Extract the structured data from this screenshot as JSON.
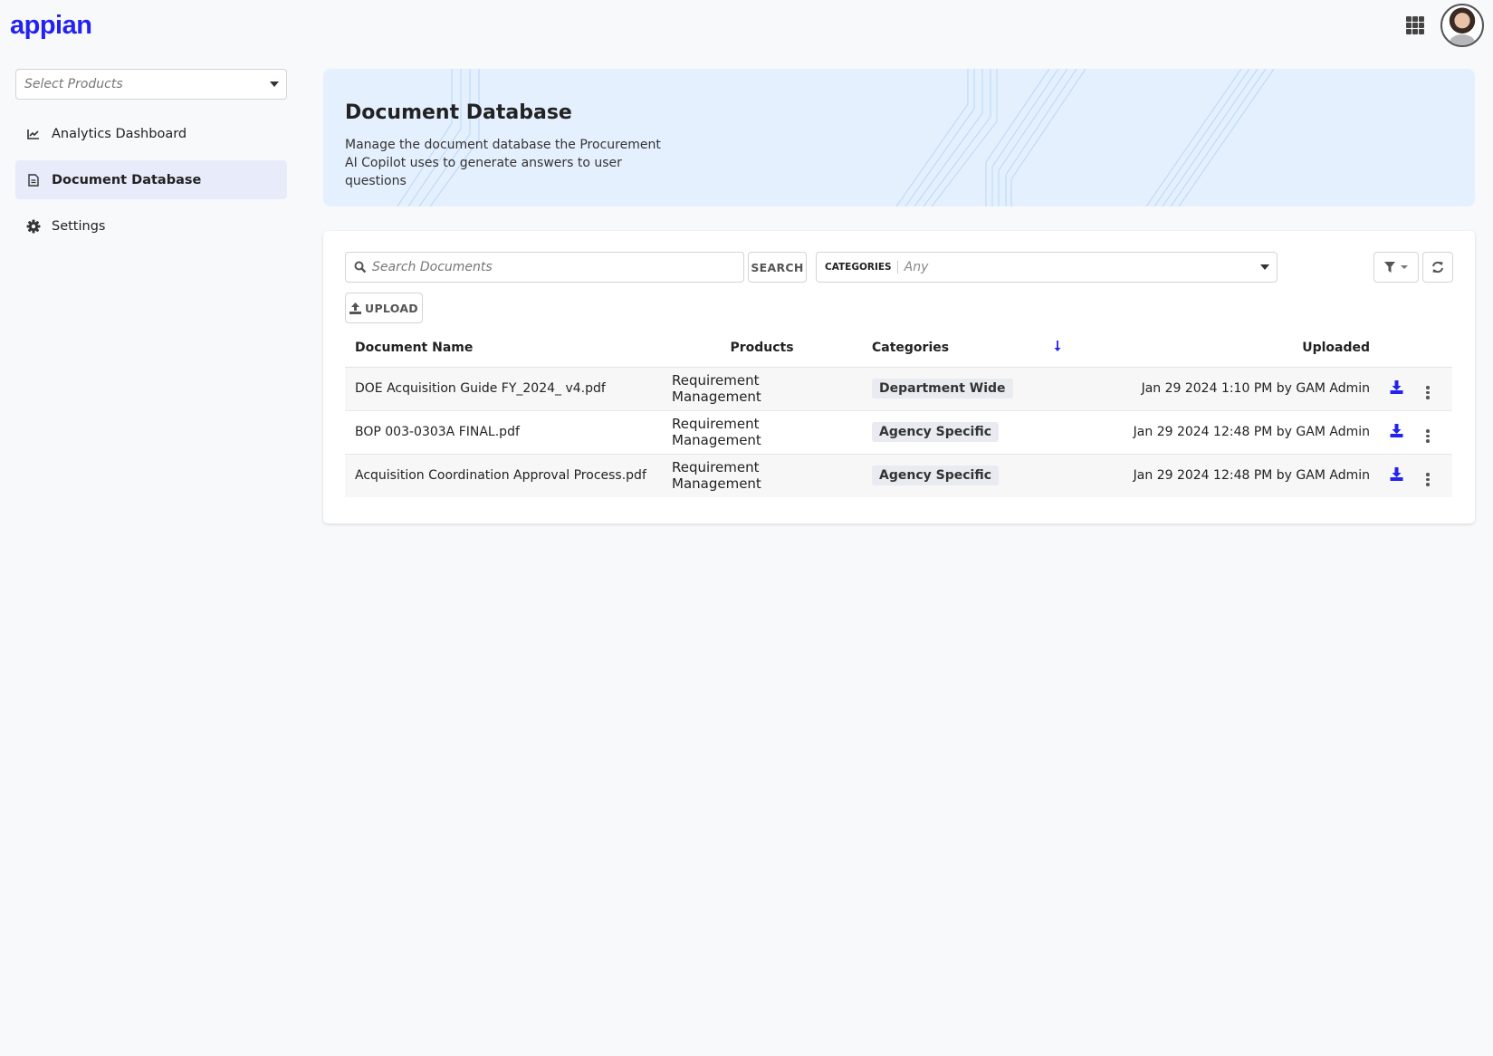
{
  "app": {
    "logo": "appian"
  },
  "topbar": {
    "apps_icon": "grid-icon",
    "avatar_alt": "user-avatar"
  },
  "sidebar": {
    "product_select": {
      "placeholder": "Select Products"
    },
    "items": [
      {
        "label": "Analytics Dashboard",
        "icon": "chart-line-icon",
        "active": false
      },
      {
        "label": "Document Database",
        "icon": "document-icon",
        "active": true
      },
      {
        "label": "Settings",
        "icon": "gear-icon",
        "active": false
      }
    ]
  },
  "header": {
    "title": "Document Database",
    "description": "Manage the document database the Procurement AI Copilot uses to generate answers to user questions"
  },
  "toolbar": {
    "search_placeholder": "Search Documents",
    "search_button": "SEARCH",
    "categories_label": "CATEGORIES",
    "categories_value": "Any",
    "upload_button": "UPLOAD"
  },
  "table": {
    "columns": {
      "name": "Document Name",
      "products": "Products",
      "categories": "Categories",
      "uploaded": "Uploaded"
    },
    "sort": {
      "direction": "descending",
      "icon": "arrow-down-icon"
    },
    "rows": [
      {
        "name": "DOE Acquisition Guide FY_2024_ v4.pdf",
        "product": "Requirement Management",
        "category": "Department Wide",
        "uploaded": "Jan 29 2024 1:10 PM by GAM Admin"
      },
      {
        "name": "BOP 003-0303A FINAL.pdf",
        "product": "Requirement Management",
        "category": "Agency Specific",
        "uploaded": "Jan 29 2024 12:48 PM by GAM Admin"
      },
      {
        "name": "Acquisition Coordination Approval Process.pdf",
        "product": "Requirement Management",
        "category": "Agency Specific",
        "uploaded": "Jan 29 2024 12:48 PM by GAM Admin"
      }
    ]
  },
  "colors": {
    "brand": "#2322f0",
    "hero_bg": "#e5f0fe",
    "active_nav_bg": "#e8ecfa"
  }
}
